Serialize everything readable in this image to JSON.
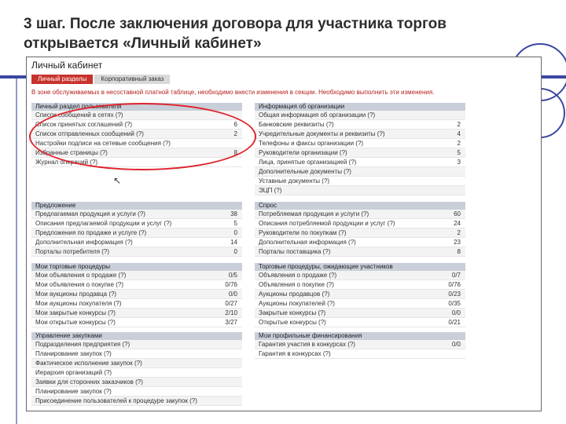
{
  "slide": {
    "title": "3 шаг. После заключения договора для участника торгов открывается «Личный кабинет»"
  },
  "cabinet": {
    "title": "Личный кабинет",
    "tabs": [
      "Личный разделы",
      "Корпоративный заказ"
    ],
    "notice": "В зоне обслуживаемых в несоставной платной таблице, необходимо внести изменения в секции. Необходимо выполнить эти изменения.",
    "panels": [
      {
        "head": "Личный раздел пользователя",
        "rows": [
          {
            "label": "Список сообщений в сетях (?)",
            "num": ""
          },
          {
            "label": "Список принятых соглашений (?)",
            "num": "6"
          },
          {
            "label": "Список отправленных сообщений (?)",
            "num": "2"
          },
          {
            "label": "Настройки подписи на сетевые сообщения (?)",
            "num": ""
          },
          {
            "label": "Избранные страницы (?)",
            "num": "8"
          },
          {
            "label": "Журнал операций (?)",
            "num": ""
          }
        ]
      },
      {
        "head": "Информация об организации",
        "rows": [
          {
            "label": "Общая информация об организации (?)",
            "num": ""
          },
          {
            "label": "Банковские реквизиты (?)",
            "num": "2"
          },
          {
            "label": "Учредительные документы и реквизиты (?)",
            "num": "4"
          },
          {
            "label": "Телефоны и факсы организации (?)",
            "num": "2"
          },
          {
            "label": "Руководители организации (?)",
            "num": "5"
          },
          {
            "label": "Лица, принятые организацией (?)",
            "num": "3"
          },
          {
            "label": "Дополнительные документы (?)",
            "num": ""
          },
          {
            "label": "Уставные документы (?)",
            "num": ""
          },
          {
            "label": "ЭЦП (?)",
            "num": ""
          }
        ]
      },
      {
        "head": "Предложение",
        "rows": [
          {
            "label": "Предлагаемая продукция и услуги (?)",
            "num": "38"
          },
          {
            "label": "Описания предлагаемой продукции и услуг (?)",
            "num": "5"
          },
          {
            "label": "Предложения по продаже и услуге (?)",
            "num": "0"
          },
          {
            "label": "Дополнительная информация (?)",
            "num": "14"
          },
          {
            "label": "Порталы потребителя (?)",
            "num": "0"
          }
        ]
      },
      {
        "head": "Спрос",
        "rows": [
          {
            "label": "Потребляемая продукция и услуги (?)",
            "num": "60"
          },
          {
            "label": "Описания потребляемой продукции и услуг (?)",
            "num": "24"
          },
          {
            "label": "Руководители по покупкам (?)",
            "num": "2"
          },
          {
            "label": "Дополнительная информация (?)",
            "num": "23"
          },
          {
            "label": "Порталы поставщика (?)",
            "num": "8"
          }
        ]
      },
      {
        "head": "Мои торговые процедуры",
        "rows": [
          {
            "label": "Мои объявления о продаже (?)",
            "num": "0/5"
          },
          {
            "label": "Мои объявления о покупке (?)",
            "num": "0/76"
          },
          {
            "label": "Мои аукционы продавца (?)",
            "num": "0/0"
          },
          {
            "label": "Мои аукционы покупателя (?)",
            "num": "0/27"
          },
          {
            "label": "Мои закрытые конкурсы (?)",
            "num": "2/10"
          },
          {
            "label": "Мои открытые конкурсы (?)",
            "num": "3/27"
          }
        ]
      },
      {
        "head": "Торговые процедуры, ожидающие участников",
        "rows": [
          {
            "label": "Объявления о продаже (?)",
            "num": "0/7"
          },
          {
            "label": "Объявления о покупке (?)",
            "num": "0/76"
          },
          {
            "label": "Аукционы продавцов (?)",
            "num": "0/23"
          },
          {
            "label": "Аукционы покупателей (?)",
            "num": "0/35"
          },
          {
            "label": "Закрытые конкурсы (?)",
            "num": "0/0"
          },
          {
            "label": "Открытые конкурсы (?)",
            "num": "0/21"
          }
        ]
      },
      {
        "head": "Управление закупками",
        "rows": [
          {
            "label": "Подразделения предприятия (?)",
            "num": ""
          },
          {
            "label": "Планирование закупок (?)",
            "num": ""
          },
          {
            "label": "Фактическое исполнение закупок (?)",
            "num": ""
          },
          {
            "label": "Иерархия организаций (?)",
            "num": ""
          },
          {
            "label": "Заявки для сторонних заказчиков (?)",
            "num": ""
          },
          {
            "label": "Планирование закупок (?)",
            "num": ""
          },
          {
            "label": "Присоединение пользователей к процедуре закупок (?)",
            "num": ""
          }
        ]
      },
      {
        "head": "Мои профильные финансирования",
        "rows": [
          {
            "label": "Гарантия участия в конкурсах (?)",
            "num": "0/0"
          },
          {
            "label": "Гарантия в конкурсах (?)",
            "num": ""
          }
        ]
      }
    ]
  }
}
